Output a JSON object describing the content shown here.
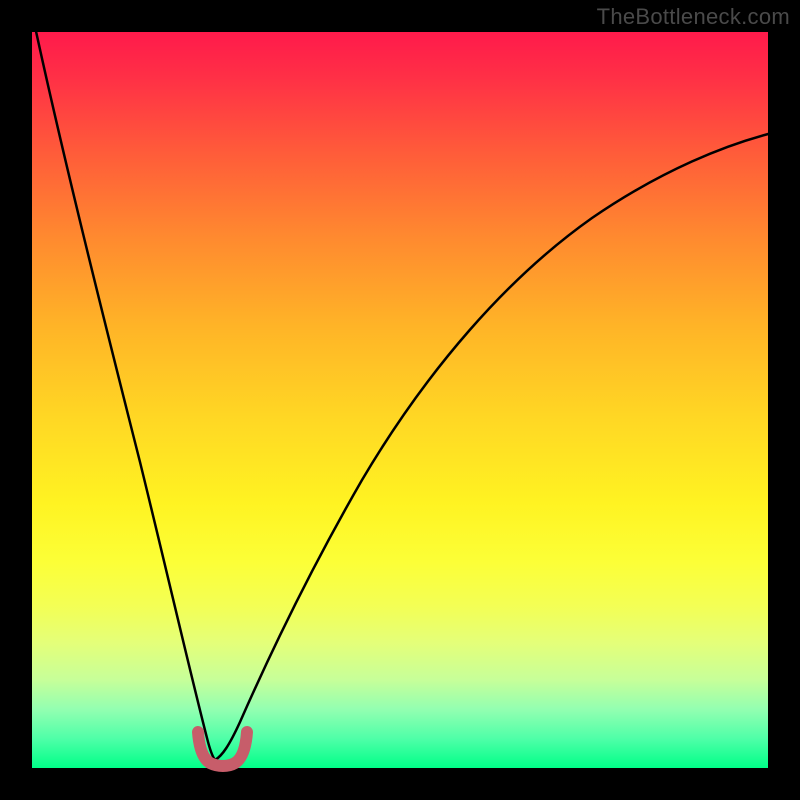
{
  "watermark": "TheBottleneck.com",
  "chart_data": {
    "type": "line",
    "title": "",
    "xlabel": "",
    "ylabel": "",
    "xlim": [
      0,
      1
    ],
    "ylim": [
      0,
      1
    ],
    "series": [
      {
        "name": "bottleneck-curve",
        "x": [
          0.0,
          0.03,
          0.06,
          0.09,
          0.12,
          0.15,
          0.18,
          0.21,
          0.235,
          0.25,
          0.265,
          0.3,
          0.34,
          0.4,
          0.48,
          0.58,
          0.7,
          0.84,
          1.0
        ],
        "y": [
          1.0,
          0.88,
          0.76,
          0.64,
          0.51,
          0.38,
          0.24,
          0.1,
          0.015,
          0.0,
          0.015,
          0.11,
          0.25,
          0.41,
          0.55,
          0.67,
          0.76,
          0.82,
          0.86
        ],
        "color": "#000000"
      },
      {
        "name": "minimum-marker",
        "x": [
          0.225,
          0.232,
          0.24,
          0.25,
          0.26,
          0.268,
          0.275
        ],
        "y": [
          0.045,
          0.02,
          0.006,
          0.0,
          0.006,
          0.02,
          0.045
        ],
        "color": "#c75d6a"
      }
    ],
    "annotations": []
  },
  "colors": {
    "background_top": "#ff1a4b",
    "background_bottom": "#00ff88",
    "curve": "#000000",
    "marker": "#c75d6a",
    "frame": "#000000",
    "watermark": "#4a4a4a"
  }
}
